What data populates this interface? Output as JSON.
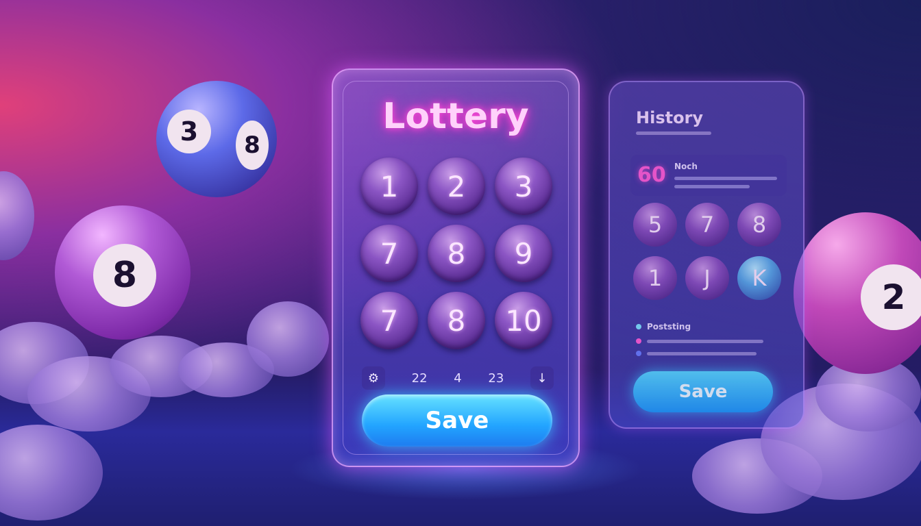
{
  "colors": {
    "accent_pink": "#ff4ad8",
    "accent_cyan": "#22a4ff",
    "background": "#2a1c6e"
  },
  "decor": {
    "ball_a_numbers": [
      "3",
      "8"
    ],
    "ball_b_number": "8",
    "ball_c_number": "2"
  },
  "main_card": {
    "title": "Lottery",
    "numbers": [
      "1",
      "2",
      "3",
      "7",
      "8",
      "9",
      "7",
      "8",
      "10"
    ],
    "controls": {
      "left_icon": "settings-icon",
      "values": [
        "22",
        "4",
        "23"
      ],
      "right_icon": "arrow-down-icon"
    },
    "save_label": "Save"
  },
  "history_card": {
    "title": "History",
    "highlight_value": "60",
    "highlight_label": "Noch",
    "numbers": [
      "5",
      "7",
      "8",
      "1",
      "J",
      "K"
    ],
    "list_label": "Poststing",
    "save_label": "Save"
  }
}
